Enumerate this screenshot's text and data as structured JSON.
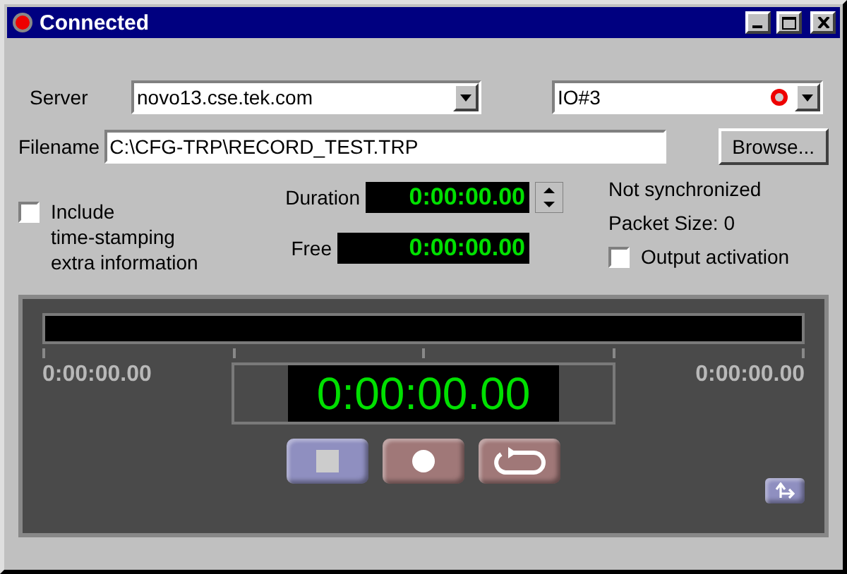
{
  "window": {
    "title": "Connected"
  },
  "server": {
    "label": "Server",
    "value": "novo13.cse.tek.com"
  },
  "device": {
    "value": "IO#3"
  },
  "filename": {
    "label": "Filename",
    "value": "C:\\CFG-TRP\\RECORD_TEST.TRP"
  },
  "browse_button": "Browse...",
  "include_option": {
    "label_lines": [
      "Include",
      "time-stamping",
      "extra information"
    ],
    "checked": false
  },
  "duration": {
    "label": "Duration",
    "value": "0:00:00.00"
  },
  "free": {
    "label": "Free",
    "value": "0:00:00.00"
  },
  "sync_status": "Not synchronized",
  "packet_size": "Packet Size: 0",
  "output_option": {
    "label": "Output activation",
    "checked": false
  },
  "player": {
    "start_time": "0:00:00.00",
    "end_time": "0:00:00.00",
    "current_time": "0:00:00.00",
    "buttons": [
      {
        "kind": "stop"
      },
      {
        "kind": "record"
      },
      {
        "kind": "loop"
      }
    ]
  }
}
